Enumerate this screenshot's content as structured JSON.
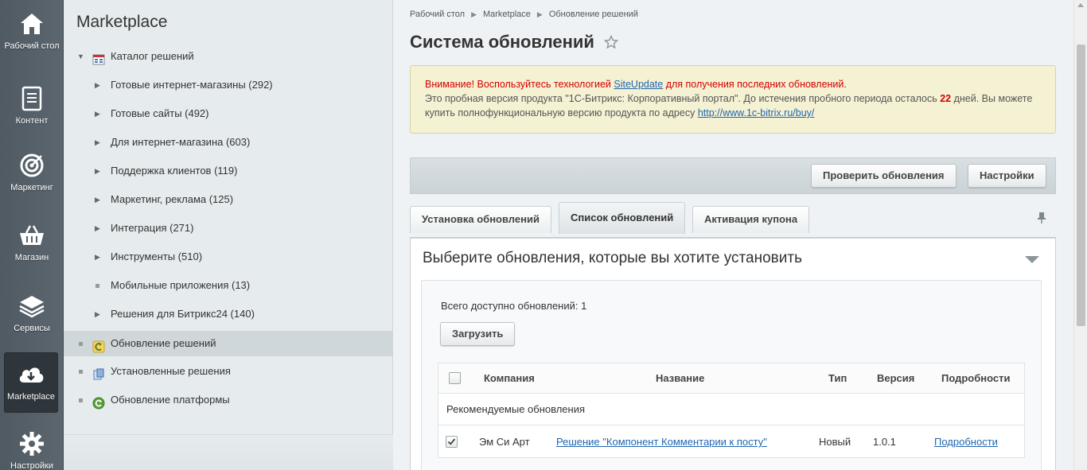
{
  "leftbar": {
    "items": [
      {
        "label": "Рабочий стол",
        "icon": "home-icon"
      },
      {
        "label": "Контент",
        "icon": "document-icon"
      },
      {
        "label": "Маркетинг",
        "icon": "target-icon"
      },
      {
        "label": "Магазин",
        "icon": "basket-icon"
      },
      {
        "label": "Сервисы",
        "icon": "layers-icon"
      },
      {
        "label": "Marketplace",
        "icon": "cloud-download-icon"
      },
      {
        "label": "Настройки",
        "icon": "gear-icon"
      }
    ]
  },
  "menu": {
    "title": "Marketplace",
    "catalog": "Каталог решений",
    "items": [
      "Готовые интернет-магазины (292)",
      "Готовые сайты (492)",
      "Для интернет-магазина (603)",
      "Поддержка клиентов (119)",
      "Маркетинг, реклама (125)",
      "Интеграция (271)",
      "Инструменты (510)",
      "Мобильные приложения (13)",
      "Решения для Битрикс24 (140)"
    ],
    "update_solutions": "Обновление решений",
    "installed_solutions": "Установленные решения",
    "platform_update": "Обновление платформы"
  },
  "breadcrumb": [
    "Рабочий стол",
    "Marketplace",
    "Обновление решений"
  ],
  "page_title": "Система обновлений",
  "notice": {
    "warn_prefix": "Внимание! Воспользуйтесь технологией ",
    "warn_link": "SiteUpdate",
    "warn_suffix": " для получения последних обновлений.",
    "trial_prefix": "Это пробная версия продукта \"1С-Битрикс: Корпоративный портал\". До истечения пробного периода осталось ",
    "days": "22",
    "trial_middle": " дней. Вы можете купить полнофункциональную версию продукта по адресу ",
    "buy_link": "http://www.1c-bitrix.ru/buy/"
  },
  "toolbar": {
    "check_updates": "Проверить обновления",
    "settings": "Настройки"
  },
  "tabs": [
    "Установка обновлений",
    "Список обновлений",
    "Активация купона"
  ],
  "panel": {
    "title": "Выберите обновления, которые вы хотите установить",
    "available": "Всего доступно обновлений: 1",
    "load_button": "Загрузить"
  },
  "table": {
    "headers": {
      "company": "Компания",
      "name": "Название",
      "type": "Тип",
      "version": "Версия",
      "details": "Подробности"
    },
    "group": "Рекомендуемые обновления",
    "row": {
      "company": "Эм Си Арт",
      "name": "Решение \"Компонент Комментарии к посту\"",
      "type": "Новый",
      "version": "1.0.1",
      "details": "Подробности"
    }
  },
  "colors": {
    "accent_link": "#2067b0",
    "warning_red": "#d50000",
    "notice_bg": "#f5f1d3"
  }
}
